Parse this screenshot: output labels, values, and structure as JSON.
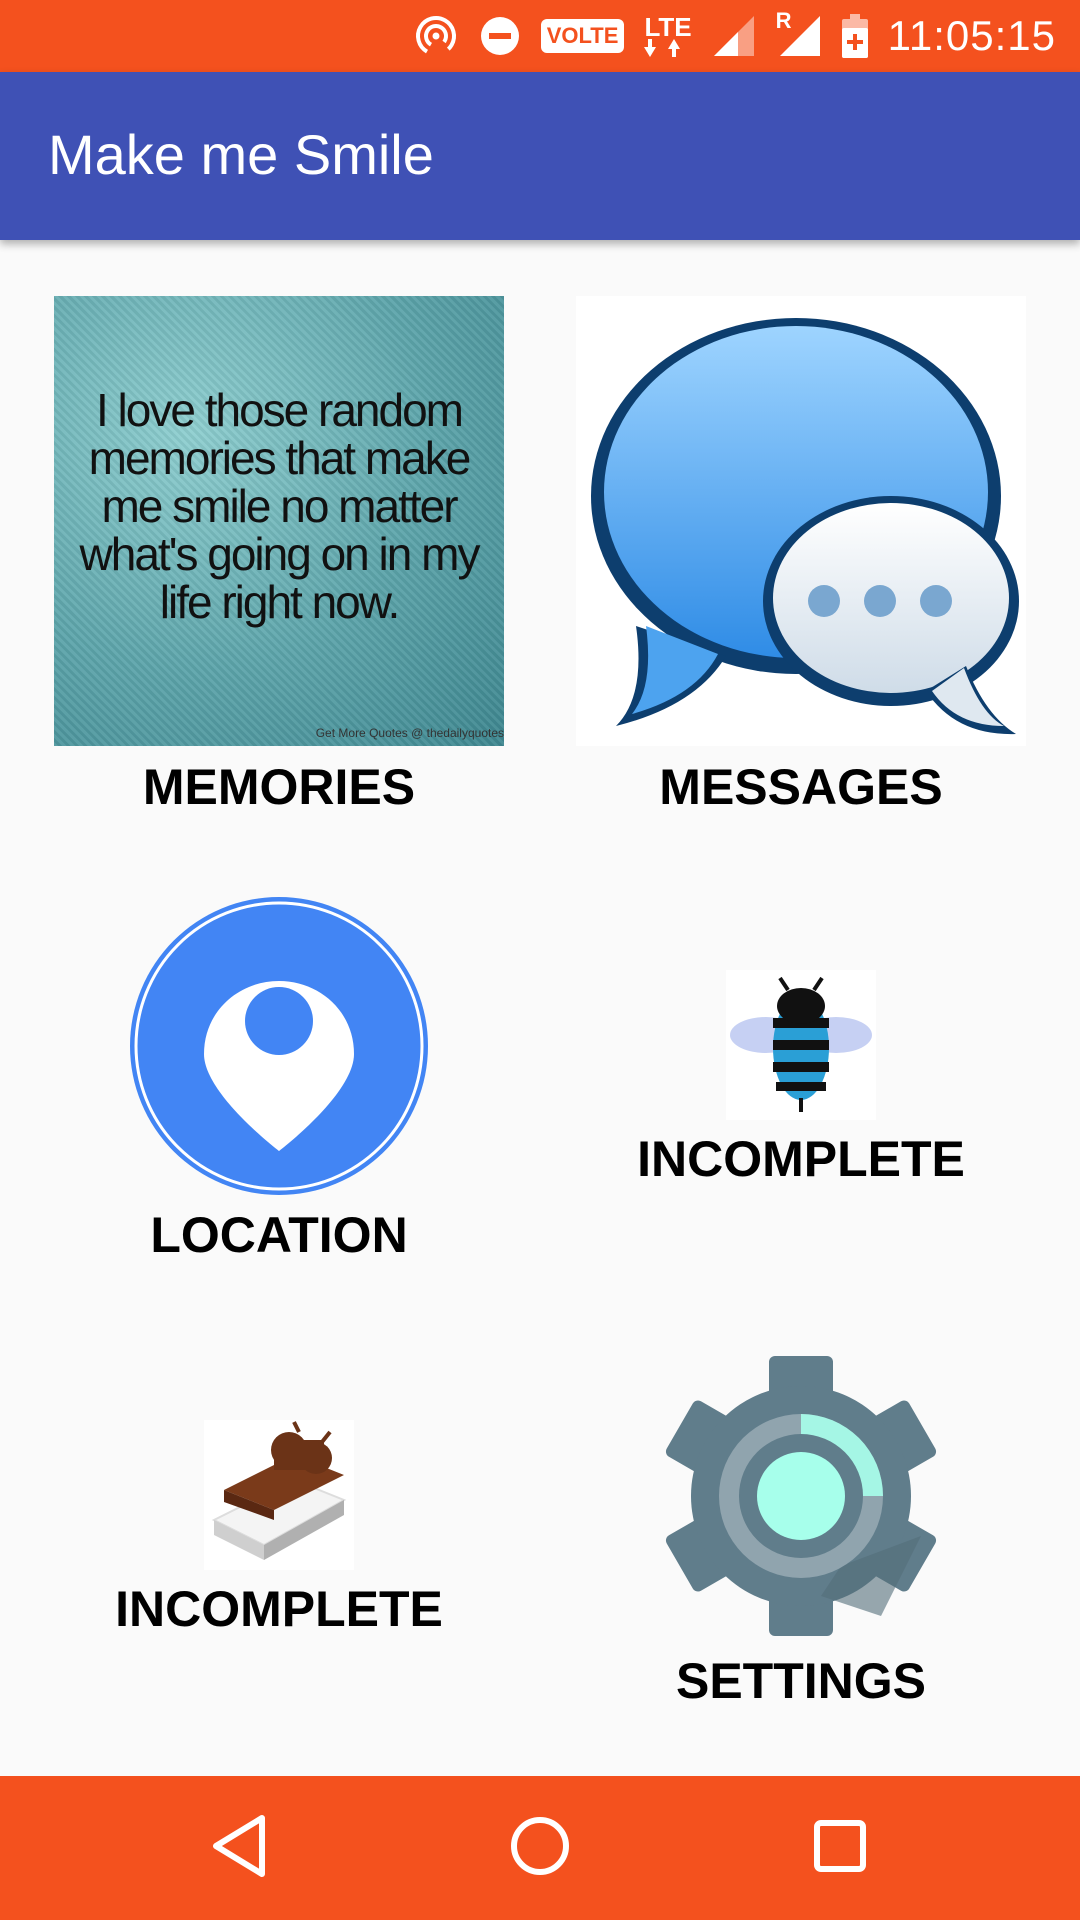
{
  "status_bar": {
    "time": "11:05:15",
    "volte": "VOLTE",
    "lte": "LTE",
    "roaming": "R",
    "icons": [
      "hotspot-icon",
      "do-not-disturb-icon",
      "volte-icon",
      "lte-icon",
      "signal-icon",
      "roaming-signal-icon",
      "battery-charging-icon"
    ]
  },
  "app_bar": {
    "title": "Make me Smile"
  },
  "quote_image_text": "I love those random memories that make me smile no matter what's going on in my life right now.",
  "quote_image_credit": "Get More Quotes @ thedailyquotes",
  "tiles": [
    {
      "label": "MEMORIES",
      "icon": "quote-image"
    },
    {
      "label": "MESSAGES",
      "icon": "messages-icon"
    },
    {
      "label": "LOCATION",
      "icon": "location-pin-icon"
    },
    {
      "label": "INCOMPLETE",
      "icon": "honeycomb-bee-icon"
    },
    {
      "label": "INCOMPLETE",
      "icon": "ice-cream-sandwich-icon"
    },
    {
      "label": "SETTINGS",
      "icon": "settings-gear-icon"
    }
  ],
  "colors": {
    "status_bar": "#f4511e",
    "app_bar": "#3f51b5",
    "nav_bar": "#f4511e",
    "location_blue": "#4285f4"
  },
  "nav_bar": {
    "buttons": [
      "back-icon",
      "home-icon",
      "recents-icon"
    ]
  }
}
